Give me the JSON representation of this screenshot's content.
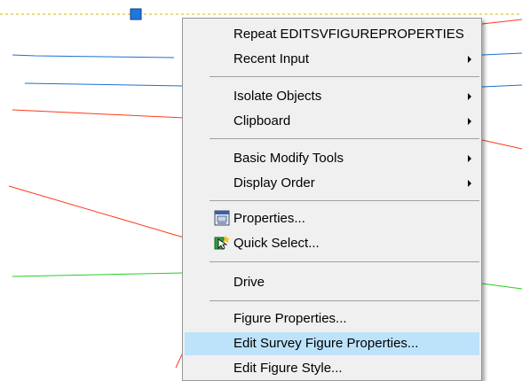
{
  "menu": {
    "items": [
      {
        "label": "Repeat EDITSVFIGUREPROPERTIES",
        "submenu": false
      },
      {
        "label": "Recent Input",
        "submenu": true
      },
      {
        "label": "Isolate Objects",
        "submenu": true
      },
      {
        "label": "Clipboard",
        "submenu": true
      },
      {
        "label": "Basic Modify Tools",
        "submenu": true
      },
      {
        "label": "Display Order",
        "submenu": true
      },
      {
        "label": "Properties...",
        "icon": "properties-icon"
      },
      {
        "label": "Quick Select...",
        "icon": "quick-select-icon"
      },
      {
        "label": "Drive"
      },
      {
        "label": "Figure Properties..."
      },
      {
        "label": "Edit Survey Figure Properties...",
        "highlighted": true
      },
      {
        "label": "Edit Figure Style..."
      }
    ]
  },
  "colors": {
    "menu_bg": "#f0f0f0",
    "highlight": "#bde3fb",
    "blue_line": "#1f6fd1",
    "red_line": "#ff3a1a",
    "green_line": "#22d022",
    "grip": "#1e78e0",
    "dashed_line": "#d8b400"
  }
}
